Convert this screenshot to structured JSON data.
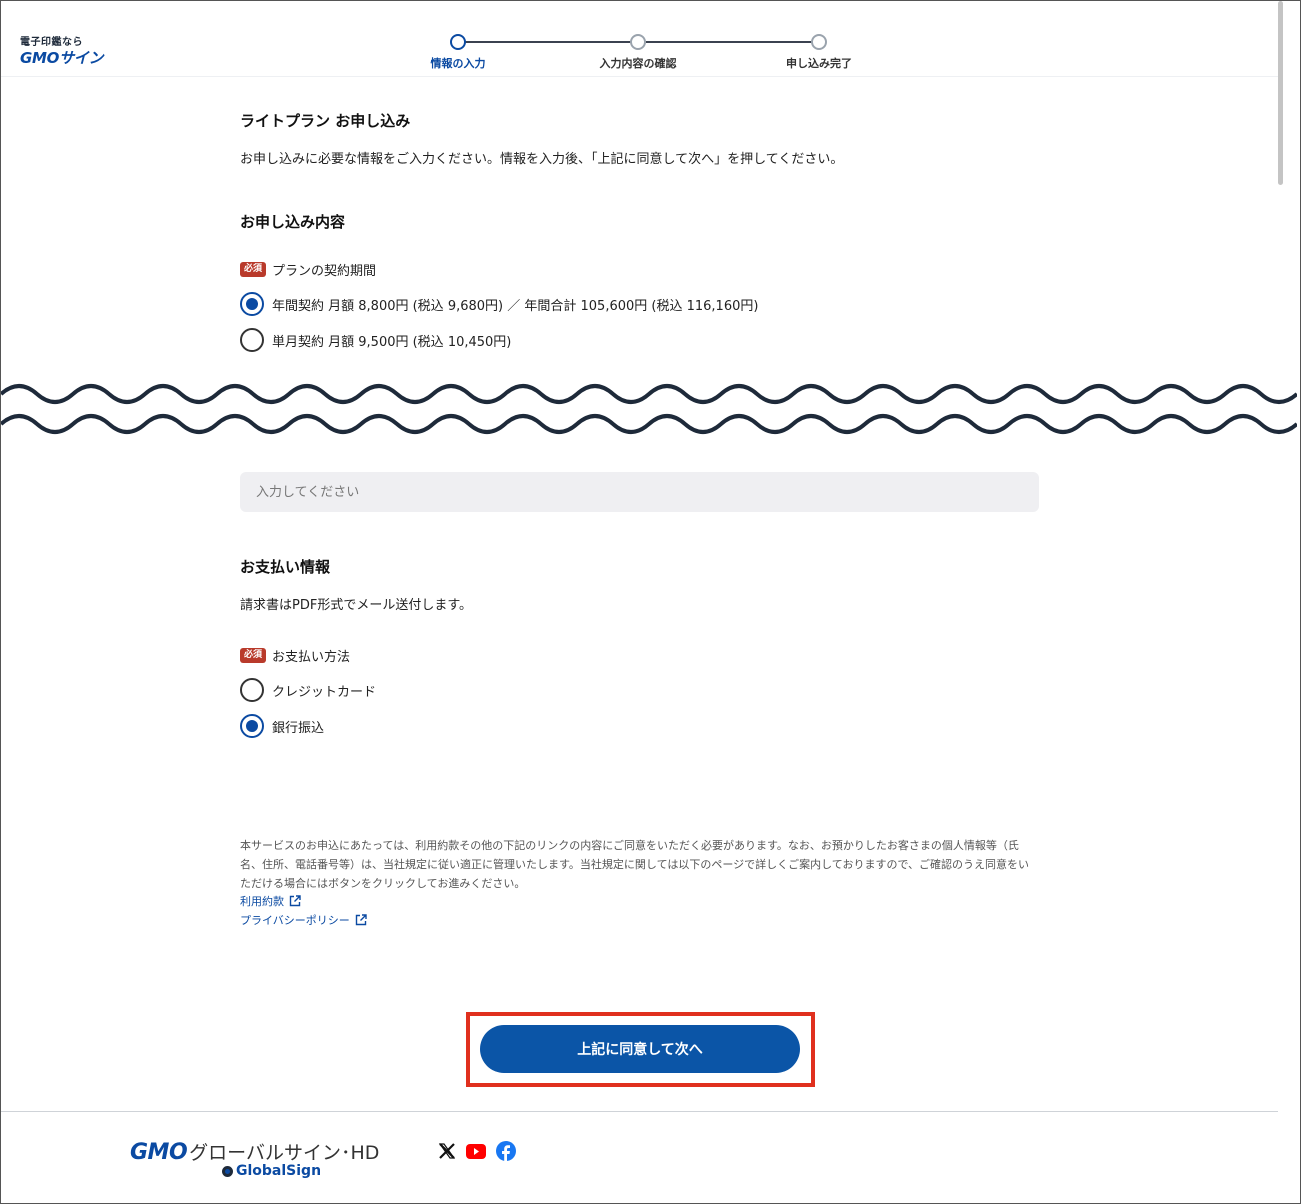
{
  "header": {
    "logo_sub": "電子印鑑なら",
    "logo_main": "GMOサイン",
    "steps": [
      {
        "label": "情報の入力",
        "active": true
      },
      {
        "label": "入力内容の確認",
        "active": false
      },
      {
        "label": "申し込み完了",
        "active": false
      }
    ]
  },
  "page": {
    "title": "ライトプラン お申し込み",
    "lead": "お申し込みに必要な情報をご入力ください。情報を入力後、「上記に同意して次へ」を押してください。"
  },
  "application": {
    "heading": "お申し込み内容",
    "required_badge": "必須",
    "field_label": "プランの契約期間",
    "options": [
      {
        "label": "年間契約 月額 8,800円 (税込 9,680円) ／ 年間合計 105,600円 (税込 116,160円)",
        "checked": true
      },
      {
        "label": "単月契約 月額 9,500円 (税込 10,450円)",
        "checked": false
      }
    ]
  },
  "input": {
    "placeholder": "入力してください"
  },
  "payment": {
    "heading": "お支払い情報",
    "description": "請求書はPDF形式でメール送付します。",
    "required_badge": "必須",
    "field_label": "お支払い方法",
    "options": [
      {
        "label": "クレジットカード",
        "checked": false
      },
      {
        "label": "銀行振込",
        "checked": true
      }
    ]
  },
  "consent": {
    "note": "本サービスのお申込にあたっては、利用約款その他の下記のリンクの内容にご同意をいただく必要があります。なお、お預かりしたお客さまの個人情報等（氏名、住所、電話番号等）は、当社規定に従い適正に管理いたします。当社規定に関しては以下のページで詳しくご案内しておりますので、ご確認のうえ同意をいただける場合にはボタンをクリックしてお進みください。",
    "links": [
      "利用約款",
      "プライバシーポリシー"
    ],
    "submit_label": "上記に同意して次へ"
  },
  "footer": {
    "company_logo": "GMO",
    "company_name": "グローバルサイン･HD",
    "sub_brand": "GlobalSign",
    "social_icons": [
      "x-icon",
      "youtube-icon",
      "facebook-icon"
    ]
  },
  "colors": {
    "brand_blue": "#0b55a7",
    "required_red": "#b93a2b",
    "highlight_red": "#e0301e"
  }
}
